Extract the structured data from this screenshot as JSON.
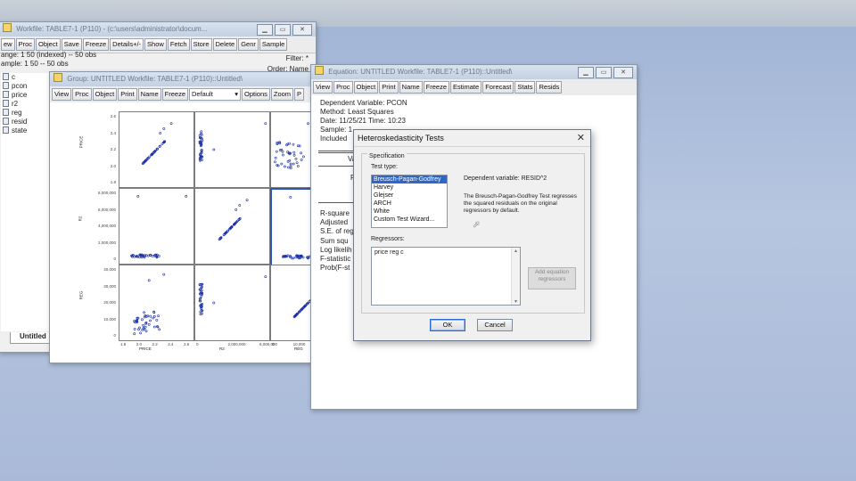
{
  "workfile_window": {
    "title": "Workfile: TABLE7-1 (P110) - (c:\\users\\administrator\\docum...",
    "toolbar": [
      "ew",
      "Proc",
      "Object",
      "Save",
      "Freeze",
      "Details+/-",
      "Show",
      "Fetch",
      "Store",
      "Delete",
      "Genr",
      "Sample"
    ],
    "range_label": "ange: 1 50 (indexed)  --  50 obs",
    "sample_label": "ample: 1 50  --  50 obs",
    "filter_label": "Filter: *",
    "order_label": "Order: Name",
    "variables": [
      "c",
      "pcon",
      "price",
      "r2",
      "reg",
      "resid",
      "state"
    ],
    "tab_label": "Untitled"
  },
  "group_window": {
    "title": "Group: UNTITLED   Workfile: TABLE7-1 (P110)::Untitled\\",
    "toolbar": [
      "View",
      "Proc",
      "Object",
      "Print",
      "Name",
      "Freeze"
    ],
    "dropdown_value": "Default",
    "toolbar_right": [
      "Options",
      "Zoom",
      "P"
    ],
    "axis_labels": [
      "PRICE",
      "R2",
      "REG"
    ],
    "row_ticks": {
      "price": [
        "2.6",
        "2.4",
        "2.2",
        "2.0",
        "1.8"
      ],
      "r2": [
        "8,000,000",
        "6,000,000",
        "4,000,000",
        "2,000,000",
        "0"
      ],
      "reg": [
        "40,000",
        "30,000",
        "20,000",
        "10,000",
        "0"
      ]
    },
    "col_ticks": {
      "price": [
        "1.8",
        "2.0",
        "2.2",
        "2.4",
        "2.6"
      ],
      "r2": [
        "0",
        "2,000,000",
        "6,000,000"
      ],
      "reg": [
        "0",
        "10,000",
        "20,000",
        "3"
      ]
    }
  },
  "equation_window": {
    "title": "Equation: UNTITLED   Workfile: TABLE7-1 (P110)::Untitled\\",
    "toolbar": [
      "View",
      "Proc",
      "Object",
      "Print",
      "Name",
      "Freeze",
      "Estimate",
      "Forecast",
      "Stats",
      "Resids"
    ],
    "lines": [
      "Dependent Variable: PCON",
      "Method: Least Squares",
      "Date: 11/25/21   Time: 10:23",
      "Sample: 1",
      "Included"
    ],
    "col_header": "Va",
    "stat_labels": [
      "R-square",
      "Adjusted",
      "S.E. of reg",
      "Sum squ",
      "Log likelih",
      "F-statistic",
      "Prob(F-st"
    ]
  },
  "dialog": {
    "title": "Heteroskedasticity Tests",
    "close": "✕",
    "group_label": "Specification",
    "test_type_label": "Test type:",
    "test_types": [
      "Breusch-Pagan-Godfrey",
      "Harvey",
      "Glejser",
      "ARCH",
      "White",
      "Custom Test Wizard..."
    ],
    "selected_index": 0,
    "dependent_variable": "Dependent variable: RESID^2",
    "description": "The Breusch-Pagan-Godfrey Test regresses the squared residuals on the original regressors by default.",
    "regressors_label": "Regressors:",
    "regressors_value": "price reg c",
    "add_regressors_button": "Add equation regressors",
    "ok_button": "OK",
    "cancel_button": "Cancel"
  },
  "colors": {
    "selection": "#2f67c7",
    "scatter_points": "#1a2fa8",
    "desktop": "#a9bad8"
  }
}
